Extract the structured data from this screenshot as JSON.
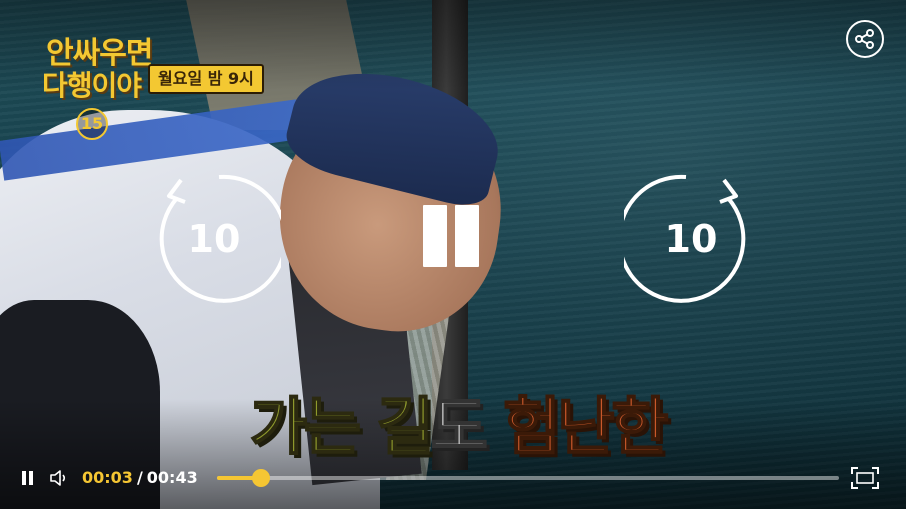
{
  "overlay": {
    "logo_line1": "안싸우면",
    "logo_line2": "다행이야",
    "airtime": "월요일 밤 9시",
    "age_rating": "15",
    "subtitle_part1": "가는 길",
    "subtitle_part2": "도 ",
    "subtitle_part3": "험난한"
  },
  "controls": {
    "seek_back_label": "10",
    "seek_forward_label": "10",
    "current_time": "00:03",
    "separator": "/",
    "total_time": "00:43",
    "progress": 0.07,
    "accent_color": "#f5c633",
    "icons": {
      "share": "share-icon",
      "replay": "replay-10-icon",
      "forward": "forward-10-icon",
      "pause": "pause-icon",
      "volume": "volume-icon",
      "fullscreen": "fullscreen-icon"
    }
  }
}
